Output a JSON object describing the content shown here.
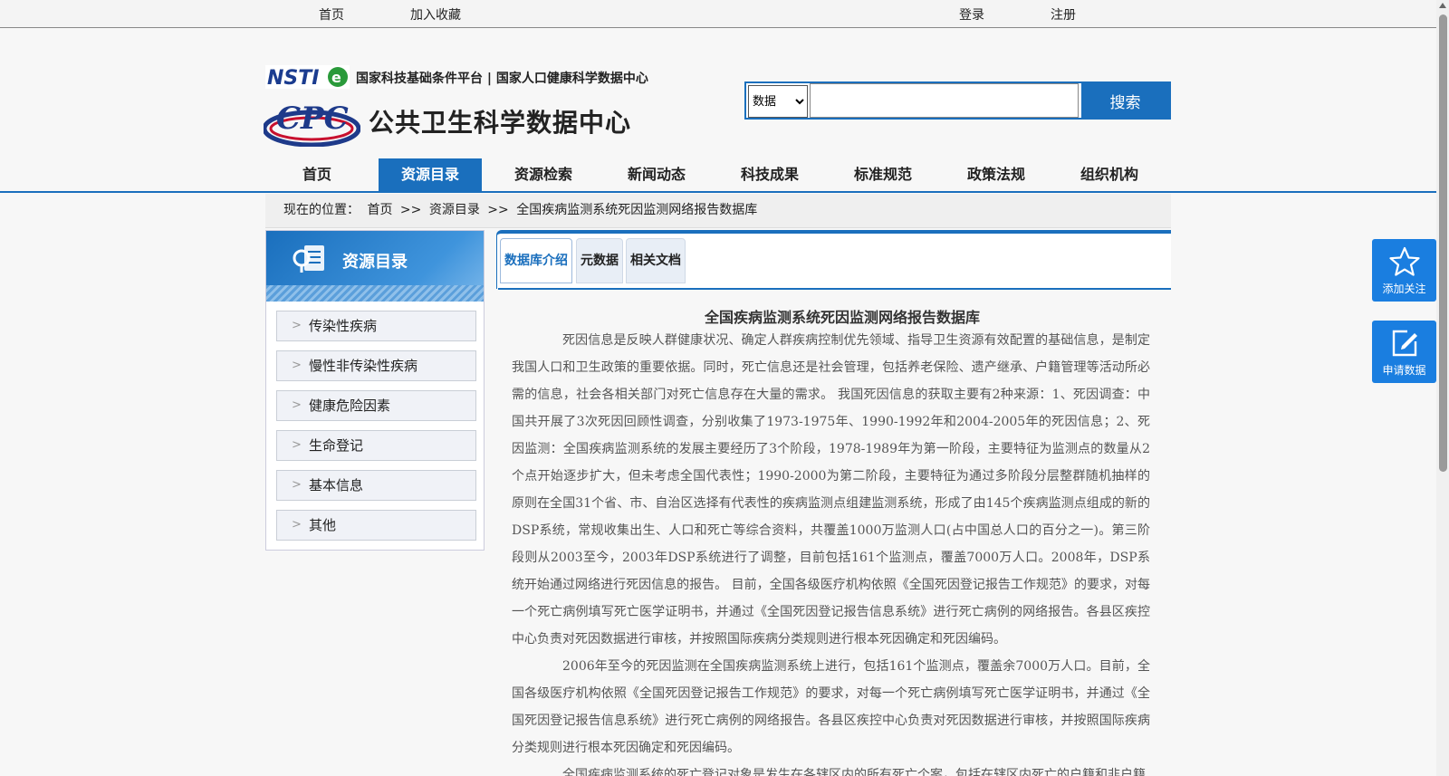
{
  "topbar": {
    "home": "首页",
    "favorite": "加入收藏",
    "login": "登录",
    "register": "注册"
  },
  "header": {
    "slogan": "国家科技基础条件平台 | 国家人口健康科学数据中心",
    "site_title": "公共卫生科学数据中心",
    "search_option": "数据",
    "search_button": "搜索"
  },
  "nav": {
    "items": [
      {
        "label": "首页"
      },
      {
        "label": "资源目录",
        "active": true
      },
      {
        "label": "资源检索"
      },
      {
        "label": "新闻动态"
      },
      {
        "label": "科技成果"
      },
      {
        "label": "标准规范"
      },
      {
        "label": "政策法规"
      },
      {
        "label": "组织机构"
      }
    ]
  },
  "breadcrumb": {
    "prefix": "现在的位置：",
    "home": "首页",
    "sep1": ">>",
    "section": "资源目录",
    "sep2": ">>",
    "current": "全国疾病监测系统死因监测网络报告数据库"
  },
  "sidebar": {
    "title": "资源目录",
    "items": [
      {
        "label": "传染性疾病"
      },
      {
        "label": "慢性非传染性疾病"
      },
      {
        "label": "健康危险因素"
      },
      {
        "label": "生命登记"
      },
      {
        "label": "基本信息"
      },
      {
        "label": "其他"
      }
    ]
  },
  "tabs": {
    "items": [
      {
        "label": "数据库介绍",
        "active": true
      },
      {
        "label": "元数据"
      },
      {
        "label": "相关文档"
      }
    ]
  },
  "article": {
    "title": "全国疾病监测系统死因监测网络报告数据库",
    "paragraphs": [
      "死因信息是反映人群健康状况、确定人群疾病控制优先领域、指导卫生资源有效配置的基础信息，是制定我国人口和卫生政策的重要依据。同时，死亡信息还是社会管理，包括养老保险、遗产继承、户籍管理等活动所必需的信息，社会各相关部门对死亡信息存在大量的需求。 我国死因信息的获取主要有2种来源：1、死因调查：中国共开展了3次死因回顾性调查，分别收集了1973-1975年、1990-1992年和2004-2005年的死因信息；2、死因监测：全国疾病监测系统的发展主要经历了3个阶段，1978-1989年为第一阶段，主要特征为监测点的数量从2个点开始逐步扩大，但未考虑全国代表性；1990-2000为第二阶段，主要特征为通过多阶段分层整群随机抽样的原则在全国31个省、市、自治区选择有代表性的疾病监测点组建监测系统，形成了由145个疾病监测点组成的新的DSP系统，常规收集出生、人口和死亡等综合资料，共覆盖1000万监测人口(占中国总人口的百分之一)。第三阶段则从2003至今，2003年DSP系统进行了调整，目前包括161个监测点，覆盖7000万人口。2008年，DSP系统开始通过网络进行死因信息的报告。 目前，全国各级医疗机构依照《全国死因登记报告工作规范》的要求，对每一个死亡病例填写死亡医学证明书，并通过《全国死因登记报告信息系统》进行死亡病例的网络报告。各县区疾控中心负责对死因数据进行审核，并按照国际疾病分类规则进行根本死因确定和死因编码。",
      "2006年至今的死因监测在全国疾病监测系统上进行，包括161个监测点，覆盖余7000万人口。目前，全国各级医疗机构依照《全国死因登记报告工作规范》的要求，对每一个死亡病例填写死亡医学证明书，并通过《全国死因登记报告信息系统》进行死亡病例的网络报告。各县区疾控中心负责对死因数据进行审核，并按照国际疾病分类规则进行根本死因确定和死因编码。",
      "全国疾病监测系统的死亡登记对象是发生在各辖区内的所有死亡个案，包括在辖区内死亡的户籍和非户籍"
    ]
  },
  "float": {
    "follow": "添加关注",
    "apply": "申请数据"
  },
  "colors": {
    "brand": "#1a6fbd",
    "float_button": "#1a7ee0"
  }
}
